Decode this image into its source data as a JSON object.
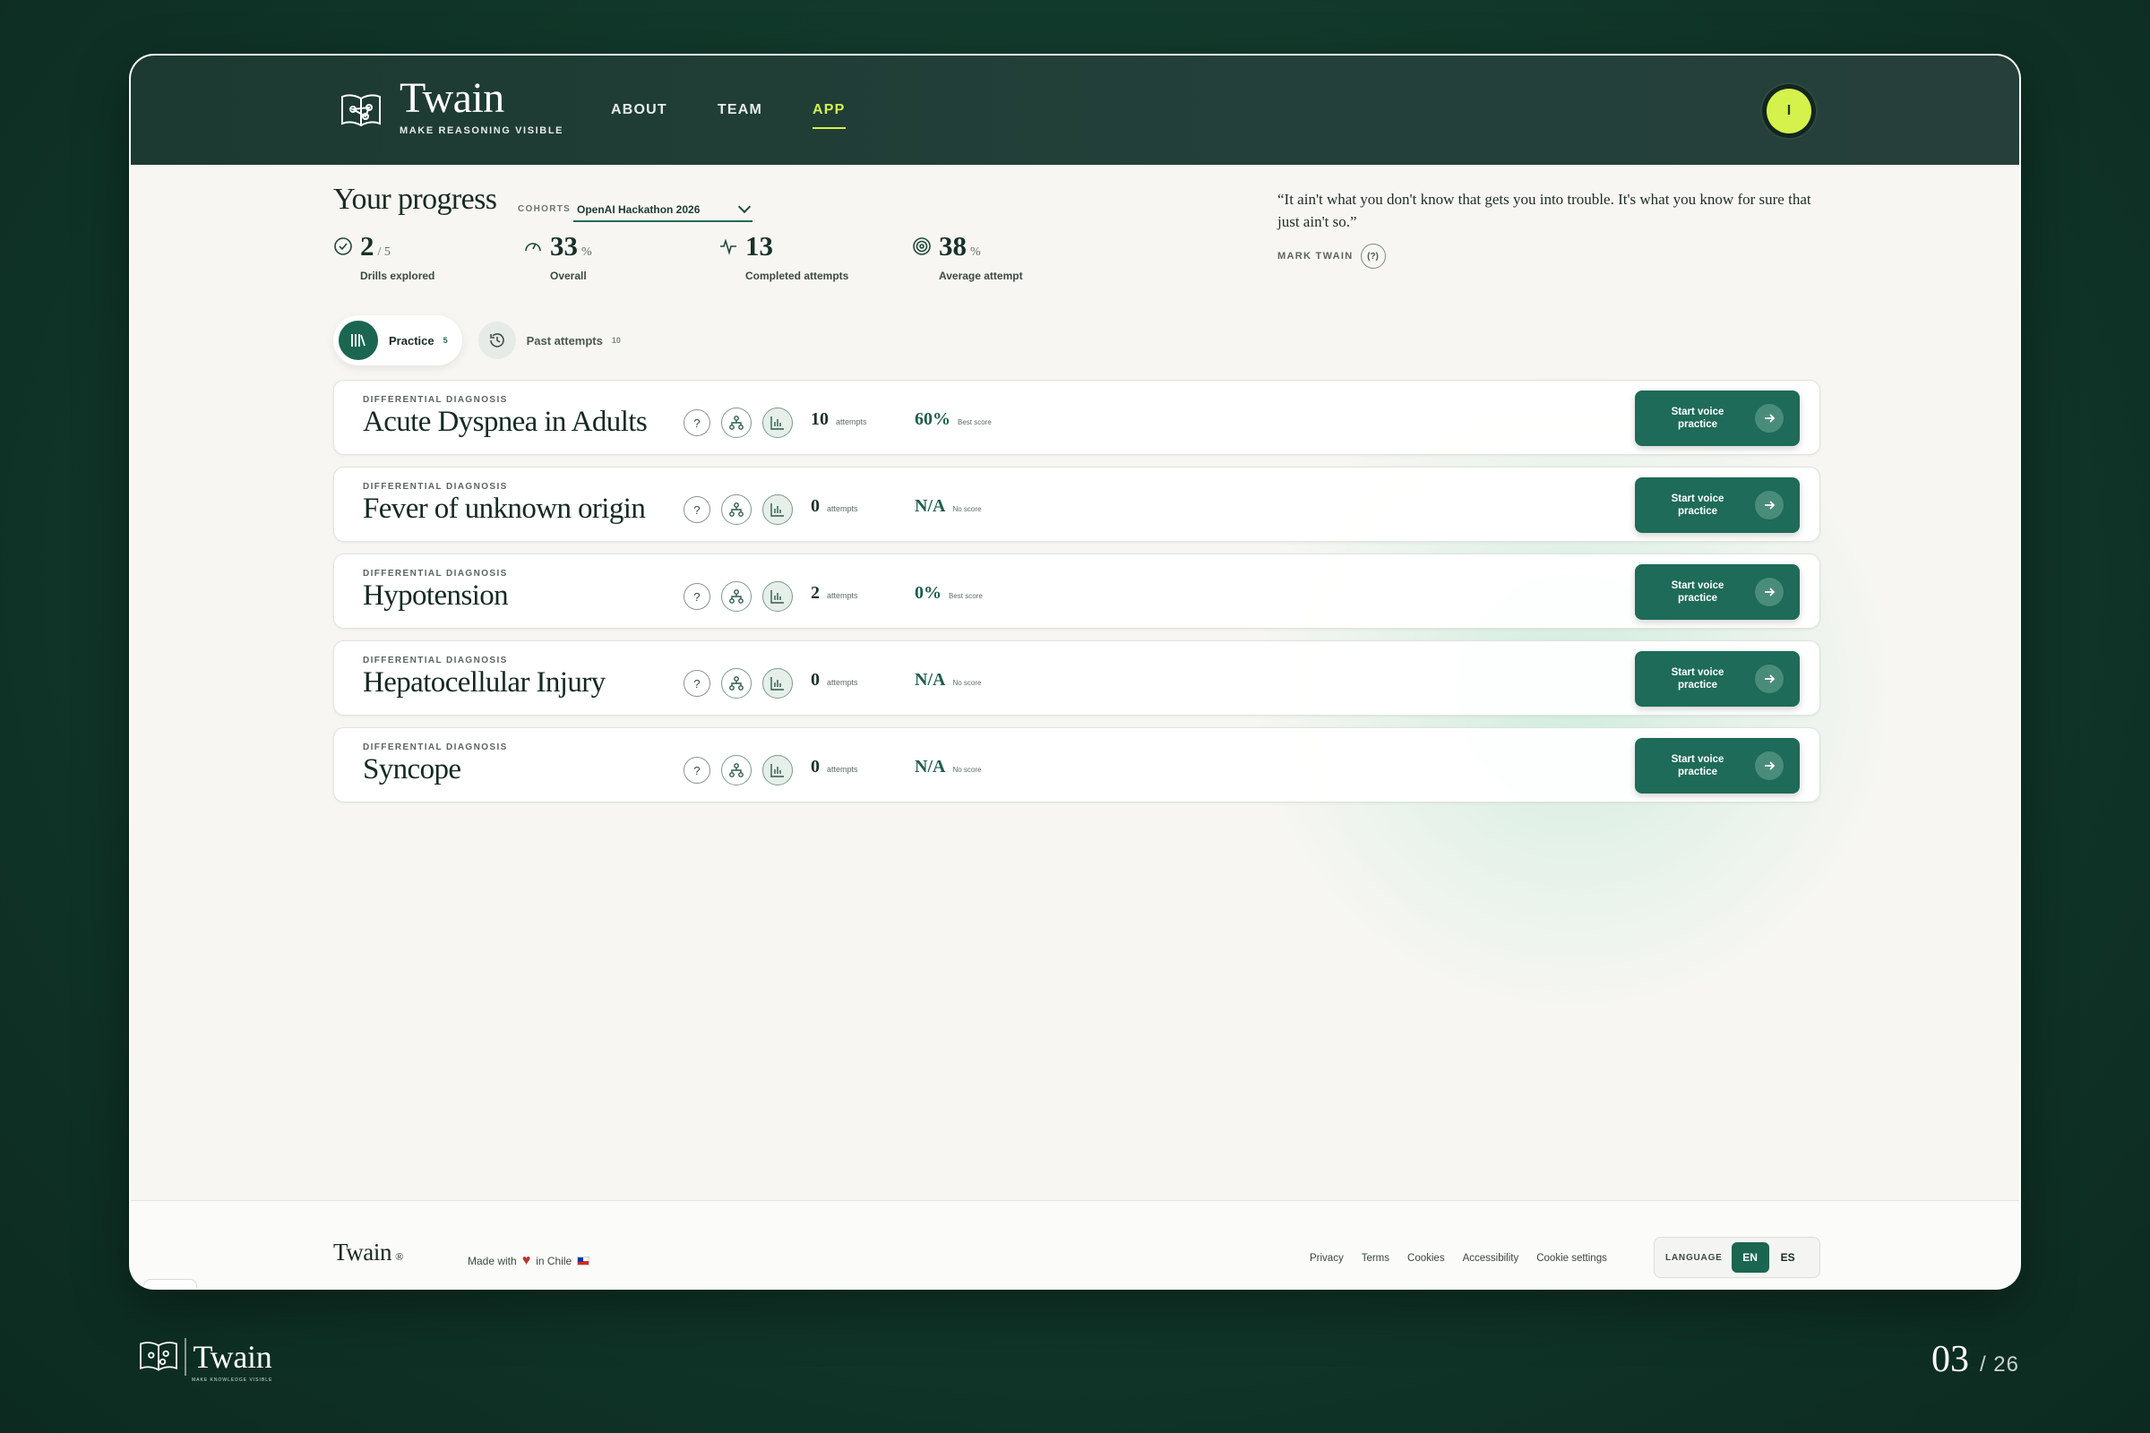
{
  "app": {
    "title": "Twain",
    "tagline": "MAKE REASONING VISIBLE",
    "nav": [
      {
        "label": "ABOUT",
        "active": false
      },
      {
        "label": "TEAM",
        "active": false
      },
      {
        "label": "APP",
        "active": true
      }
    ],
    "avatar_initial": "I"
  },
  "progress": {
    "title": "Your progress",
    "cohort_label": "COHORTS",
    "cohort_value": "OpenAI Hackathon 2026",
    "stats": [
      {
        "icon": "check-circle-icon",
        "value": "2",
        "suffix": "/ 5",
        "label": "Drills explored"
      },
      {
        "icon": "gauge-icon",
        "value": "33",
        "suffix": "%",
        "label": "Overall"
      },
      {
        "icon": "pulse-icon",
        "value": "13",
        "suffix": "",
        "label": "Completed attempts"
      },
      {
        "icon": "target-icon",
        "value": "38",
        "suffix": "%",
        "label": "Average attempt"
      }
    ]
  },
  "quote": {
    "text": "“It ain't what you don't know that gets you into trouble. It's what you know for sure that just ain't so.”",
    "author": "MARK TWAIN",
    "badge": "(?)"
  },
  "tabs": {
    "practice": {
      "label": "Practice",
      "count": "5"
    },
    "past": {
      "label": "Past attempts",
      "count": "10"
    }
  },
  "drills": [
    {
      "category": "DIFFERENTIAL DIAGNOSIS",
      "name": "Acute Dyspnea in Adults",
      "attempts": "10",
      "attempts_unit": "attempts",
      "score": "60%",
      "score_unit": "Best score",
      "button": "Start voice practice"
    },
    {
      "category": "DIFFERENTIAL DIAGNOSIS",
      "name": "Fever of unknown origin",
      "attempts": "0",
      "attempts_unit": "attempts",
      "score": "N/A",
      "score_unit": "No score",
      "button": "Start voice practice"
    },
    {
      "category": "DIFFERENTIAL DIAGNOSIS",
      "name": "Hypotension",
      "attempts": "2",
      "attempts_unit": "attempts",
      "score": "0%",
      "score_unit": "Best score",
      "button": "Start voice practice"
    },
    {
      "category": "DIFFERENTIAL DIAGNOSIS",
      "name": "Hepatocellular Injury",
      "attempts": "0",
      "attempts_unit": "attempts",
      "score": "N/A",
      "score_unit": "No score",
      "button": "Start voice practice"
    },
    {
      "category": "DIFFERENTIAL DIAGNOSIS",
      "name": "Syncope",
      "attempts": "0",
      "attempts_unit": "attempts",
      "score": "N/A",
      "score_unit": "No score",
      "button": "Start voice practice"
    }
  ],
  "footer": {
    "brand": "Twain",
    "reg": "®",
    "made_with": "Made with",
    "made_in": "in Chile",
    "links": [
      "Privacy",
      "Terms",
      "Cookies",
      "Accessibility",
      "Cookie settings"
    ],
    "language_label": "LANGUAGE",
    "lang_en": "EN",
    "lang_es": "ES"
  },
  "slide": {
    "logo_text": "Twain",
    "logo_tag": "MAKE KNOWLEDGE VISIBLE",
    "page_current": "03",
    "page_total": "/ 26"
  },
  "colors": {
    "brand_green": "#1a6650",
    "accent_lime": "#d4f24b",
    "topbar": "#1c3a31"
  }
}
